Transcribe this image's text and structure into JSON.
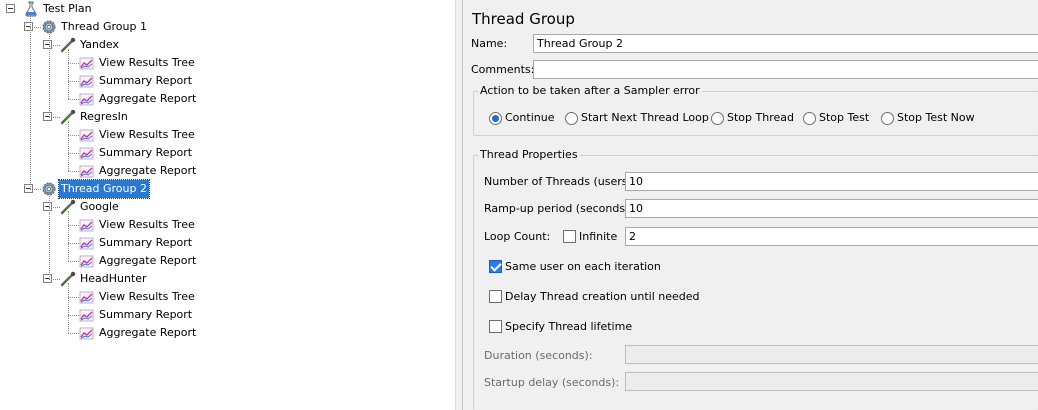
{
  "tree": {
    "root": "Test Plan",
    "groups": [
      {
        "name": "Thread Group 1",
        "selected": false,
        "samplers": [
          {
            "name": "Yandex",
            "listeners": [
              "View Results Tree",
              "Summary Report",
              "Aggregate Report"
            ]
          },
          {
            "name": "RegresIn",
            "listeners": [
              "View Results Tree",
              "Summary Report",
              "Aggregate Report"
            ]
          }
        ]
      },
      {
        "name": "Thread Group 2",
        "selected": true,
        "samplers": [
          {
            "name": "Google",
            "listeners": [
              "View Results Tree",
              "Summary Report",
              "Aggregate Report"
            ]
          },
          {
            "name": "HeadHunter",
            "listeners": [
              "View Results Tree",
              "Summary Report",
              "Aggregate Report"
            ]
          }
        ]
      }
    ]
  },
  "panel": {
    "title": "Thread Group",
    "name_label": "Name:",
    "name_value": "Thread Group 2",
    "comments_label": "Comments:",
    "comments_value": "",
    "sampler_error": {
      "legend": "Action to be taken after a Sampler error",
      "options": [
        "Continue",
        "Start Next Thread Loop",
        "Stop Thread",
        "Stop Test",
        "Stop Test Now"
      ],
      "selected": "Continue"
    },
    "thread_props": {
      "legend": "Thread Properties",
      "threads_label": "Number of Threads (users):",
      "threads_value": "10",
      "rampup_label": "Ramp-up period (seconds):",
      "rampup_value": "10",
      "loop_label": "Loop Count:",
      "infinite_label": "Infinite",
      "infinite_checked": false,
      "loop_value": "2",
      "same_user_label": "Same user on each iteration",
      "same_user_checked": true,
      "delay_label": "Delay Thread creation until needed",
      "delay_checked": false,
      "lifetime_label": "Specify Thread lifetime",
      "lifetime_checked": false,
      "duration_label": "Duration (seconds):",
      "duration_value": "",
      "startup_label": "Startup delay (seconds):",
      "startup_value": ""
    }
  },
  "colors": {
    "selection": "#2a79d0",
    "checkbox_on": "#2c7be5",
    "radio_dot": "#1f6fd0"
  }
}
